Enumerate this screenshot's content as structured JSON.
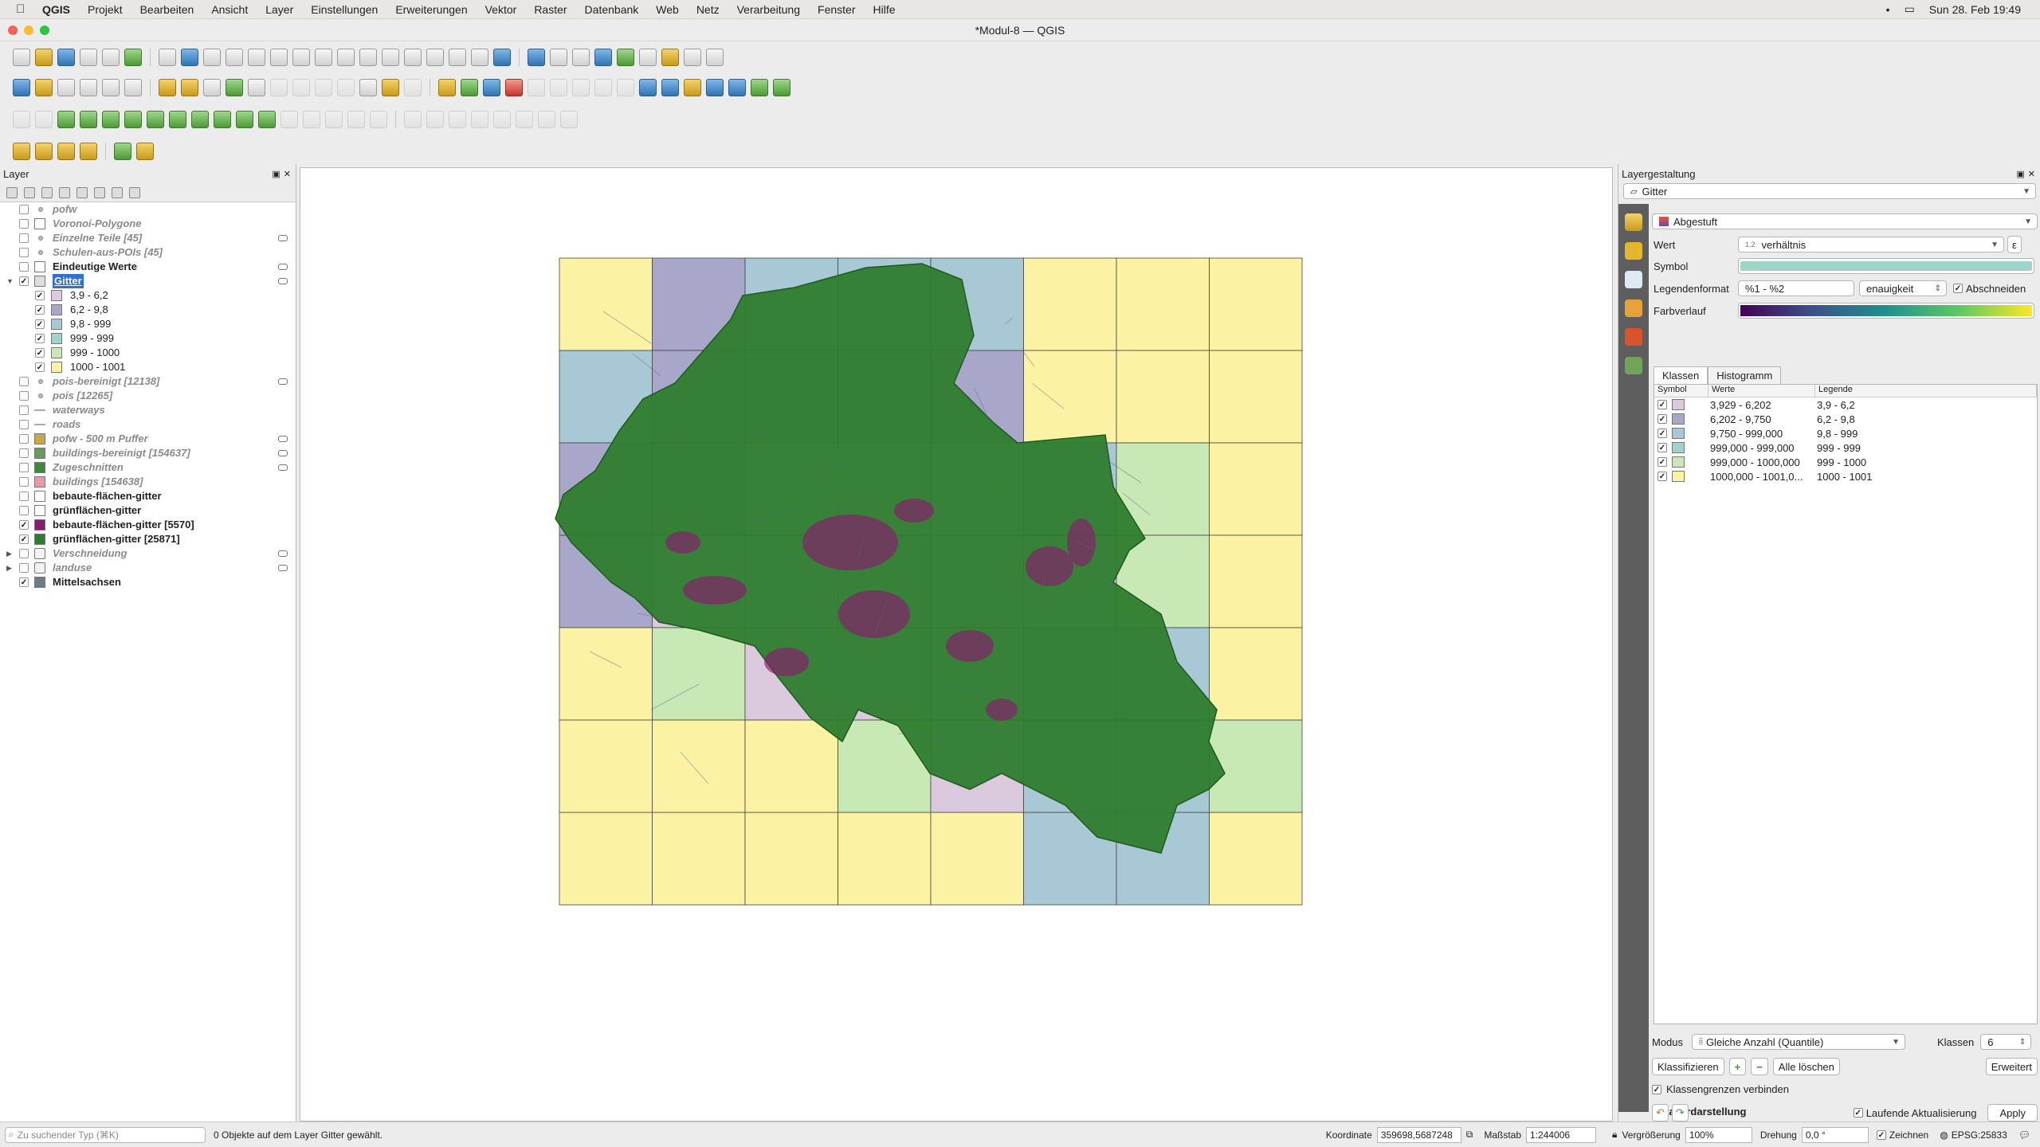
{
  "menubar": {
    "app": "QGIS",
    "items": [
      "Projekt",
      "Bearbeiten",
      "Ansicht",
      "Layer",
      "Einstellungen",
      "Erweiterungen",
      "Vektor",
      "Raster",
      "Datenbank",
      "Web",
      "Netz",
      "Verarbeitung",
      "Fenster",
      "Hilfe"
    ],
    "clock": "Sun 28. Feb  19:49"
  },
  "window": {
    "title": "*Modul-8 — QGIS"
  },
  "layers_panel": {
    "title": "Layer",
    "items": [
      {
        "label": "pofw",
        "checked": false,
        "symbol": "point",
        "italic": true
      },
      {
        "label": "Voronoi-Polygone",
        "checked": false,
        "symbol": "fill",
        "color": "#ffffff",
        "italic": true
      },
      {
        "label": "Einzelne Teile [45]",
        "checked": false,
        "symbol": "point",
        "italic": true,
        "indicator": true
      },
      {
        "label": "Schulen-aus-POIs [45]",
        "checked": false,
        "symbol": "point",
        "italic": true
      },
      {
        "label": "Eindeutige Werte",
        "checked": false,
        "symbol": "table",
        "bold": true,
        "indicator": true
      },
      {
        "label": "Gitter",
        "checked": true,
        "symbol": "fill",
        "color": "#dddddd",
        "selected": true,
        "expanded": true,
        "indicator": true
      },
      {
        "label": "3,9 - 6,2",
        "checked": true,
        "symbol": "fill",
        "color": "#dbc9dd",
        "class": true
      },
      {
        "label": "6,2 - 9,8",
        "checked": true,
        "symbol": "fill",
        "color": "#a9a7c9",
        "class": true
      },
      {
        "label": "9,8 - 999",
        "checked": true,
        "symbol": "fill",
        "color": "#a7c8d4",
        "class": true
      },
      {
        "label": "999 - 999",
        "checked": true,
        "symbol": "fill",
        "color": "#9fd5c9",
        "class": true
      },
      {
        "label": "999 - 1000",
        "checked": true,
        "symbol": "fill",
        "color": "#c8e8b6",
        "class": true
      },
      {
        "label": "1000 - 1001",
        "checked": true,
        "symbol": "fill",
        "color": "#fbf3a3",
        "class": true
      },
      {
        "label": "pois-bereinigt [12138]",
        "checked": false,
        "symbol": "point",
        "italic": true,
        "indicator": true
      },
      {
        "label": "pois [12265]",
        "checked": false,
        "symbol": "point",
        "italic": true
      },
      {
        "label": "waterways",
        "checked": false,
        "symbol": "line",
        "italic": true
      },
      {
        "label": "roads",
        "checked": false,
        "symbol": "line",
        "italic": true
      },
      {
        "label": "pofw - 500 m Puffer",
        "checked": false,
        "symbol": "fill",
        "color": "#c9a64a",
        "italic": true,
        "indicator": true
      },
      {
        "label": "buildings-bereinigt [154637]",
        "checked": false,
        "symbol": "fill",
        "color": "#6a9a5a",
        "italic": true,
        "indicator": true
      },
      {
        "label": "Zugeschnitten",
        "checked": false,
        "symbol": "fill",
        "color": "#3f8a3a",
        "italic": true,
        "indicator": true
      },
      {
        "label": "buildings [154638]",
        "checked": false,
        "symbol": "fill",
        "color": "#e89aa6",
        "italic": true
      },
      {
        "label": "bebaute-flächen-gitter",
        "checked": false,
        "symbol": "table",
        "bold": true
      },
      {
        "label": "grünflächen-gitter",
        "checked": false,
        "symbol": "table",
        "bold": true
      },
      {
        "label": "bebaute-flächen-gitter [5570]",
        "checked": true,
        "symbol": "fill",
        "color": "#8a1a6e",
        "bold": true
      },
      {
        "label": "grünflächen-gitter [25871]",
        "checked": true,
        "symbol": "fill",
        "color": "#2e7d2e",
        "bold": true
      },
      {
        "label": "Verschneidung",
        "checked": false,
        "symbol": "group",
        "italic": true,
        "collapsed": true,
        "indicator": true
      },
      {
        "label": "landuse",
        "checked": false,
        "symbol": "group",
        "italic": true,
        "collapsed": true,
        "indicator": true
      },
      {
        "label": "Mittelsachsen",
        "checked": true,
        "symbol": "fill",
        "color": "#6b7c85",
        "bold": true
      }
    ]
  },
  "map": {
    "grid_rows": [
      [
        "#fbf3a3",
        "#a9a7c9",
        "#a7c8d4",
        "#a7c8d4",
        "#a7c8d4",
        "#fbf3a3",
        "#fbf3a3",
        "#fbf3a3"
      ],
      [
        "#a7c8d4",
        "#a9a7c9",
        "#a9a7c9",
        "#a9a7c9",
        "#a9a7c9",
        "#fbf3a3",
        "#fbf3a3",
        "#fbf3a3"
      ],
      [
        "#a9a7c9",
        "#a9a7c9",
        "#dbc9dd",
        "#dbc9dd",
        "#dbc9dd",
        "#a7c8d4",
        "#c8e8b6",
        "#fbf3a3"
      ],
      [
        "#a9a7c9",
        "#dbc9dd",
        "#dbc9dd",
        "#dbc9dd",
        "#dbc9dd",
        "#dbc9dd",
        "#c8e8b6",
        "#fbf3a3"
      ],
      [
        "#fbf3a3",
        "#c8e8b6",
        "#dbc9dd",
        "#dbc9dd",
        "#dbc9dd",
        "#a7c8d4",
        "#a7c8d4",
        "#fbf3a3"
      ],
      [
        "#fbf3a3",
        "#fbf3a3",
        "#fbf3a3",
        "#c8e8b6",
        "#dbc9dd",
        "#a7c8d4",
        "#a7c8d4",
        "#c8e8b6"
      ],
      [
        "#fbf3a3",
        "#fbf3a3",
        "#fbf3a3",
        "#fbf3a3",
        "#fbf3a3",
        "#a7c8d4",
        "#a7c8d4",
        "#fbf3a3"
      ]
    ],
    "green_color": "#2e7d2e",
    "builtup_color": "#8a1a6e"
  },
  "styling_panel": {
    "title": "Layergestaltung",
    "layer": "Gitter",
    "renderer": "Abgestuft",
    "wert_label": "Wert",
    "wert_prefix": "1.2",
    "wert_value": "verhältnis",
    "symbol_label": "Symbol",
    "symbol_color": "#9fd5c9",
    "legendenformat_label": "Legendenformat",
    "legendenformat_value": "%1 - %2",
    "genauigkeit": "enauigkeit",
    "abschneiden": "Abschneiden",
    "farbverlauf_label": "Farbverlauf",
    "tab_klassen": "Klassen",
    "tab_histogramm": "Histogramm",
    "col_symbol": "Symbol",
    "col_werte": "Werte",
    "col_legende": "Legende",
    "classes": [
      {
        "werte": "3,929 - 6,202",
        "legende": "3,9 - 6,2",
        "color": "#dbc9dd"
      },
      {
        "werte": "6,202 - 9,750",
        "legende": "6,2 - 9,8",
        "color": "#a9a7c9"
      },
      {
        "werte": "9,750 - 999,000",
        "legende": "9,8 - 999",
        "color": "#a7c8d4"
      },
      {
        "werte": "999,000 - 999,000",
        "legende": "999 - 999",
        "color": "#9fd5c9"
      },
      {
        "werte": "999,000 - 1000,000",
        "legende": "999 - 1000",
        "color": "#c8e8b6"
      },
      {
        "werte": "1000,000 - 1001,0...",
        "legende": "1000 - 1001",
        "color": "#fbf3a3"
      }
    ],
    "modus_label": "Modus",
    "modus_value": "Gleiche Anzahl (Quantile)",
    "klassen_label": "Klassen",
    "klassen_value": "6",
    "klassifizieren": "Klassifizieren",
    "alle_loeschen": "Alle löschen",
    "erweitert": "Erweitert",
    "klassengrenzen": "Klassengrenzen verbinden",
    "layerdarstellung": "Layerdarstellung",
    "laufende": "Laufende Aktualisierung",
    "apply": "Apply"
  },
  "statusbar": {
    "search_placeholder": "Zu suchender Typ (⌘K)",
    "message": "0 Objekte auf dem Layer Gitter gewählt.",
    "koordinate_label": "Koordinate",
    "koordinate": "359698,5687248",
    "massstab_label": "Maßstab",
    "massstab": "1:244006",
    "vergroesserung_label": "Vergrößerung",
    "vergroesserung": "100%",
    "drehung_label": "Drehung",
    "drehung": "0,0 °",
    "zeichnen": "Zeichnen",
    "epsg": "EPSG:25833"
  }
}
